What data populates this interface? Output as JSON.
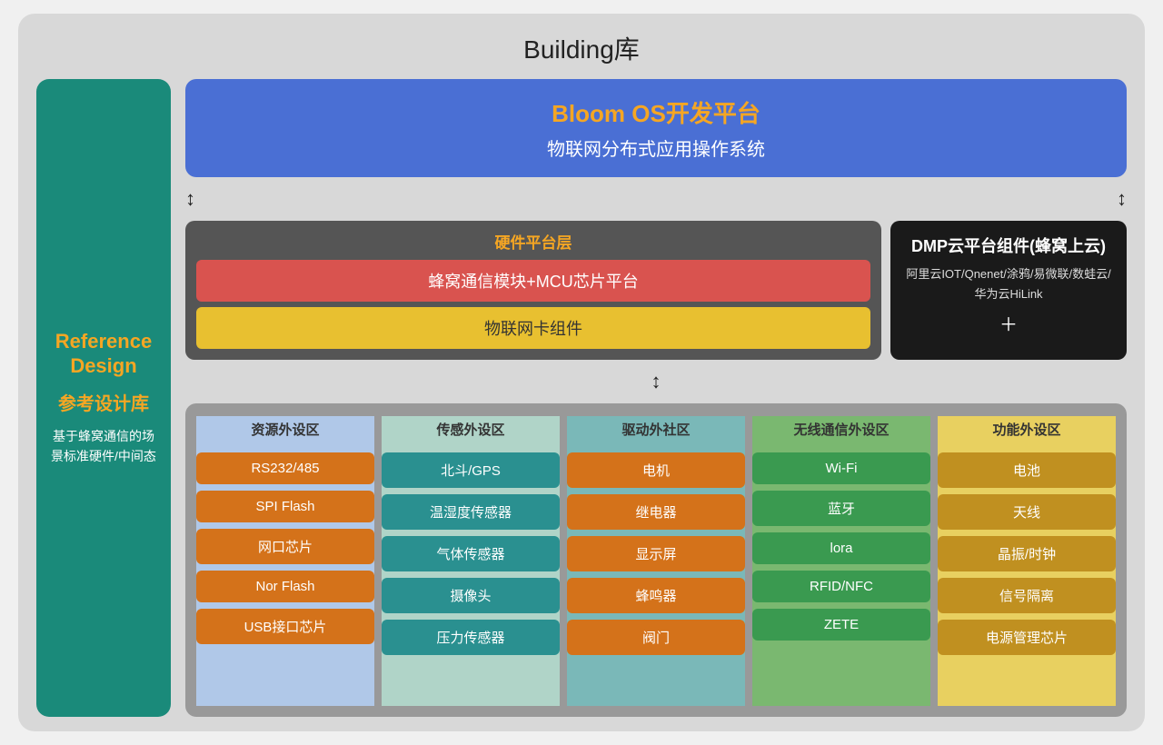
{
  "title": "Building库",
  "sidebar": {
    "ref1": "Reference",
    "ref2": "Design",
    "ref_cn": "参考设计库",
    "desc": "基于蜂窝通信的场景标准硬件/中间态"
  },
  "bloom": {
    "title": "Bloom OS开发平台",
    "subtitle": "物联网分布式应用操作系统"
  },
  "hardware": {
    "title": "硬件平台层",
    "comm": "蜂窝通信模块+MCU芯片平台",
    "iot": "物联网卡组件"
  },
  "dmp": {
    "title": "DMP云平台组件(蜂窝上云)",
    "desc": "阿里云IOT/Qnenet/涂鸦/易微联/数蛙云/\n华为云HiLink",
    "plus": "＋"
  },
  "peripherals": {
    "columns": [
      {
        "id": "resource",
        "header": "资源外设区",
        "items": [
          "RS232/485",
          "SPI Flash",
          "网口芯片",
          "Nor Flash",
          "USB接口芯片"
        ]
      },
      {
        "id": "sensor",
        "header": "传感外设区",
        "items": [
          "北斗/GPS",
          "温湿度传感器",
          "气体传感器",
          "摄像头",
          "压力传感器"
        ]
      },
      {
        "id": "driver",
        "header": "驱动外社区",
        "items": [
          "电机",
          "继电器",
          "显示屏",
          "蜂鸣器",
          "阀门"
        ]
      },
      {
        "id": "wireless",
        "header": "无线通信外设区",
        "items": [
          "Wi-Fi",
          "蓝牙",
          "lora",
          "RFID/NFC",
          "ZETE"
        ]
      },
      {
        "id": "function",
        "header": "功能外设区",
        "items": [
          "电池",
          "天线",
          "晶振/时钟",
          "信号隔离",
          "电源管理芯片"
        ]
      }
    ]
  }
}
